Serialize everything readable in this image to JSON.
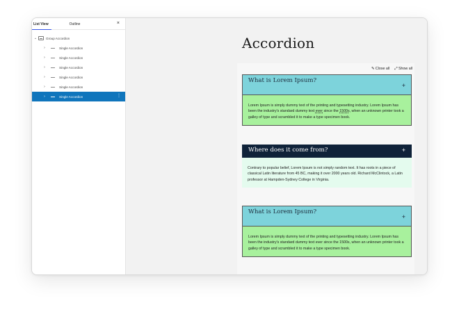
{
  "sidebar": {
    "tabs": {
      "list_view": "List View",
      "outline": "Outline"
    },
    "close": "×",
    "group_label": "Group Accordion",
    "items": [
      {
        "label": "Single Accordion"
      },
      {
        "label": "Single Accordion"
      },
      {
        "label": "Single Accordion"
      },
      {
        "label": "Single Accordion"
      },
      {
        "label": "Single Accordion"
      },
      {
        "label": "Single Accordion",
        "selected": true
      }
    ]
  },
  "page": {
    "title": "Accordion"
  },
  "controls": {
    "close_all": "Close all",
    "show_all": "Show all"
  },
  "accordion": [
    {
      "title": "What is Lorem Ipsum?",
      "text_1": "Lorem Ipsum is simply dummy text of the printing and typesetting industry. Lorem Ipsum has been the industry's standard dummy text ",
      "text_ever": "ever",
      "text_2": " since the ",
      "text_1500s": "1500s",
      "text_3": ", when an unknown printer took a galley of type and scrambled it to make a type specimen book."
    },
    {
      "title": "Where does it come from?",
      "text": "Contrary to popular belief, Lorem Ipsum is not simply random text. It has roots in a piece of classical Latin literature from 45 BC, making it over 2000 years old. Richard McClintock, a Latin professor at Hampden-Sydney College in Virginia."
    },
    {
      "title": "What is Lorem Ipsum?",
      "text": "Lorem Ipsum is simply dummy text of the printing and typesetting industry. Lorem Ipsum has been the industry's standard dummy text ever since the 1500s, when an unknown printer took a galley of type and scrambled it to make a type specimen book."
    }
  ],
  "icons": {
    "plus": "+",
    "close_all_icon": "✎",
    "show_all_icon": "⤢"
  },
  "colors": {
    "header_light": "#7dd3db",
    "header_dark": "#0f2239",
    "body_green": "#a8f19d",
    "body_mint": "#e4fbee",
    "selected": "#0f75bc"
  }
}
